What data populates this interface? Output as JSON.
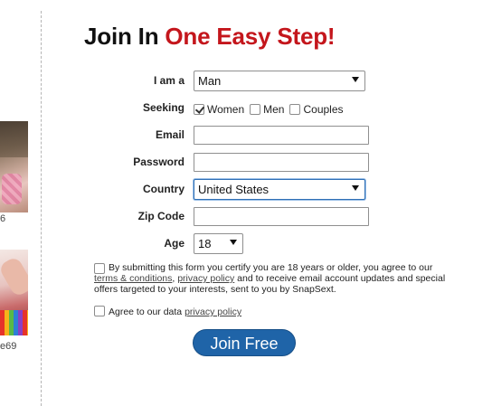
{
  "left_strip": {
    "thumb1_label": "6",
    "thumb2_label": "e69"
  },
  "heading": {
    "part1": "Join In ",
    "part2": "One Easy Step!"
  },
  "colors": {
    "heading_accent": "#c4161c",
    "button": "#1f64a8"
  },
  "form": {
    "iam": {
      "label": "I am a",
      "value": "Man"
    },
    "seeking": {
      "label": "Seeking",
      "options": [
        {
          "label": "Women",
          "checked": true
        },
        {
          "label": "Men",
          "checked": false
        },
        {
          "label": "Couples",
          "checked": false
        }
      ]
    },
    "email": {
      "label": "Email",
      "value": ""
    },
    "password": {
      "label": "Password",
      "value": ""
    },
    "country": {
      "label": "Country",
      "value": "United States"
    },
    "zip": {
      "label": "Zip Code",
      "value": ""
    },
    "age": {
      "label": "Age",
      "value": "18"
    }
  },
  "legal": {
    "before": "By submitting this form you certify you are 18 years or older, you agree to our ",
    "terms_link": "terms & conditions",
    "comma": ", ",
    "privacy_link": "privacy policy",
    "after": " and to receive email account updates and special offers targeted to your interests, sent to you by SnapSext."
  },
  "agree": {
    "text": "Agree to our data ",
    "link": "privacy policy"
  },
  "submit": {
    "label": "Join Free"
  }
}
